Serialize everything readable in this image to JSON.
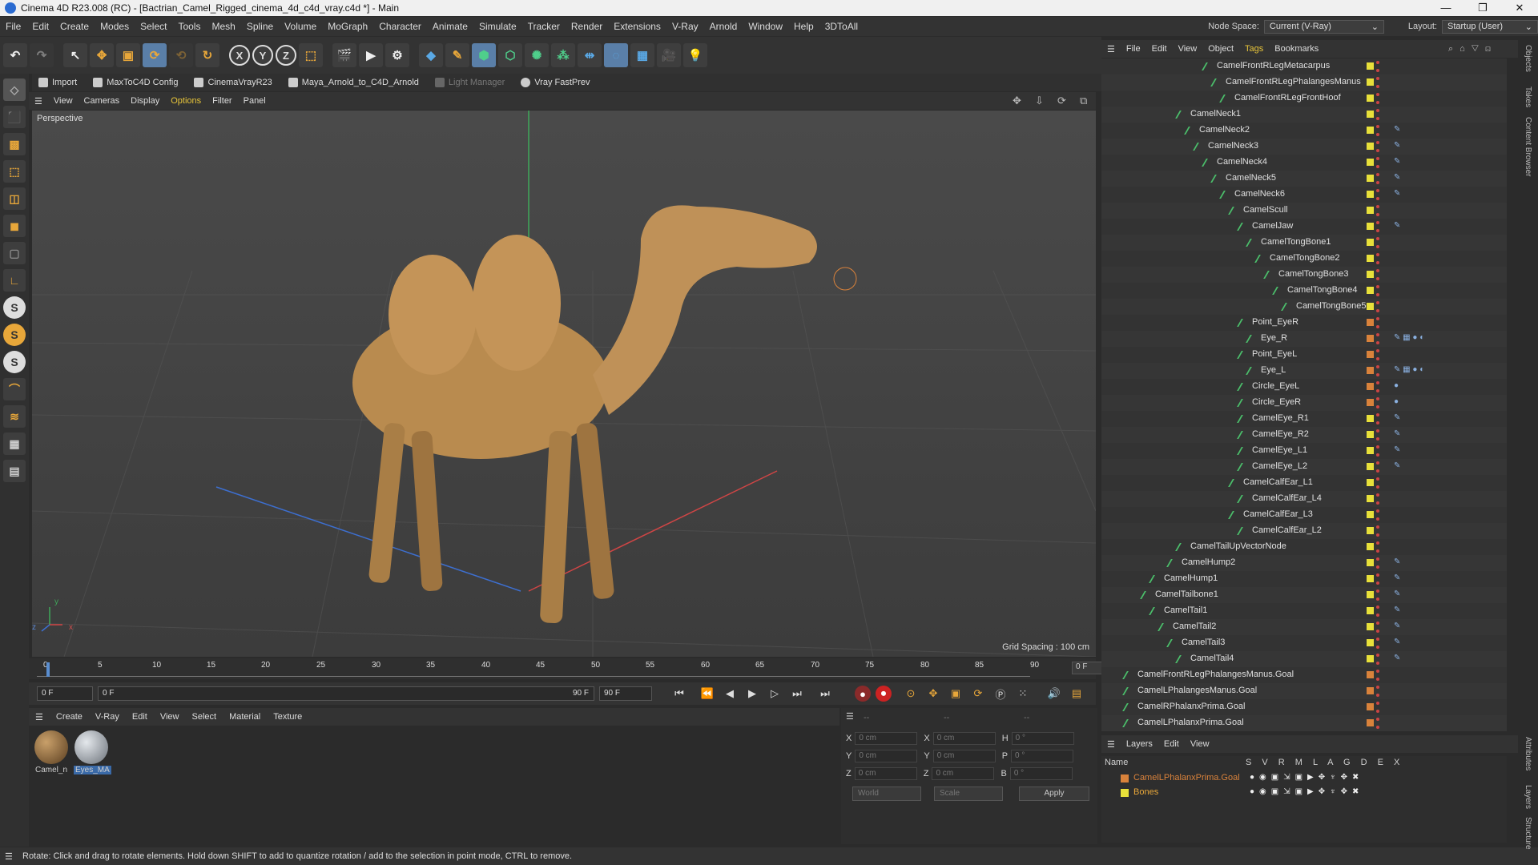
{
  "window": {
    "title": "Cinema 4D R23.008 (RC) - [Bactrian_Camel_Rigged_cinema_4d_c4d_vray.c4d *] - Main"
  },
  "menubar": {
    "items": [
      "File",
      "Edit",
      "Create",
      "Modes",
      "Select",
      "Tools",
      "Mesh",
      "Spline",
      "Volume",
      "MoGraph",
      "Character",
      "Animate",
      "Simulate",
      "Tracker",
      "Render",
      "Extensions",
      "V-Ray",
      "Arnold",
      "Window",
      "Help",
      "3DToAll"
    ],
    "node_space_label": "Node Space:",
    "node_space_value": "Current (V-Ray)",
    "layout_label": "Layout:",
    "layout_value": "Startup (User)"
  },
  "plugins": [
    "Import",
    "MaxToC4D Config",
    "CinemaVrayR23",
    "Maya_Arnold_to_C4D_Arnold",
    "Light Manager",
    "Vray FastPrev"
  ],
  "viewport": {
    "menu": [
      "View",
      "Cameras",
      "Display",
      "Options",
      "Filter",
      "Panel"
    ],
    "label": "Perspective",
    "grid_spacing": "Grid Spacing : 100 cm",
    "axis_y": "y",
    "axis_z": "z",
    "axis_x": "x"
  },
  "timeline": {
    "ticks": [
      "0",
      "5",
      "10",
      "15",
      "20",
      "25",
      "30",
      "35",
      "40",
      "45",
      "50",
      "55",
      "60",
      "65",
      "70",
      "75",
      "80",
      "85",
      "90"
    ],
    "frame_display": "0 F",
    "start_field": "0 F",
    "range_field": "0 F",
    "range_end": "90 F",
    "end_field": "90 F"
  },
  "material_manager": {
    "menu": [
      "Create",
      "V-Ray",
      "Edit",
      "View",
      "Select",
      "Material",
      "Texture"
    ],
    "materials": [
      {
        "name": "Camel_n",
        "color": "#8a6a3e"
      },
      {
        "name": "Eyes_MA",
        "color": "#9aa0a6"
      }
    ]
  },
  "coordinates": {
    "header_a": "--",
    "header_b": "--",
    "header_c": "--",
    "rows": [
      {
        "a": "X",
        "av": "0 cm",
        "b": "X",
        "bv": "0 cm",
        "c": "H",
        "cv": "0 °"
      },
      {
        "a": "Y",
        "av": "0 cm",
        "b": "Y",
        "bv": "0 cm",
        "c": "P",
        "cv": "0 °"
      },
      {
        "a": "Z",
        "av": "0 cm",
        "b": "Z",
        "bv": "0 cm",
        "c": "B",
        "cv": "0 °"
      }
    ],
    "mode": "World",
    "transform": "Scale",
    "apply": "Apply"
  },
  "status": "Rotate: Click and drag to rotate elements. Hold down SHIFT to add to quantize rotation / add to the selection in point mode, CTRL to remove.",
  "object_manager": {
    "menu": [
      "File",
      "Edit",
      "View",
      "Object",
      "Tags",
      "Bookmarks"
    ],
    "rows": [
      {
        "name": "CamelFrontRLegMetacarpus",
        "depth": 10,
        "color": "#e8e03a",
        "tags": ""
      },
      {
        "name": "CamelFrontRLegPhalangesManus",
        "depth": 11,
        "color": "#e8e03a",
        "tags": ""
      },
      {
        "name": "CamelFrontRLegFrontHoof",
        "depth": 12,
        "color": "#e8e03a",
        "tags": ""
      },
      {
        "name": "CamelNeck1",
        "depth": 7,
        "color": "#e8e03a",
        "tags": ""
      },
      {
        "name": "CamelNeck2",
        "depth": 8,
        "color": "#e8e03a",
        "tags": "✎"
      },
      {
        "name": "CamelNeck3",
        "depth": 9,
        "color": "#e8e03a",
        "tags": "✎"
      },
      {
        "name": "CamelNeck4",
        "depth": 10,
        "color": "#e8e03a",
        "tags": "✎"
      },
      {
        "name": "CamelNeck5",
        "depth": 11,
        "color": "#e8e03a",
        "tags": "✎"
      },
      {
        "name": "CamelNeck6",
        "depth": 12,
        "color": "#e8e03a",
        "tags": "✎"
      },
      {
        "name": "CamelScull",
        "depth": 13,
        "color": "#e8e03a",
        "tags": ""
      },
      {
        "name": "CamelJaw",
        "depth": 14,
        "color": "#e8e03a",
        "tags": "✎"
      },
      {
        "name": "CamelTongBone1",
        "depth": 15,
        "color": "#e8e03a",
        "tags": ""
      },
      {
        "name": "CamelTongBone2",
        "depth": 16,
        "color": "#e8e03a",
        "tags": ""
      },
      {
        "name": "CamelTongBone3",
        "depth": 17,
        "color": "#e8e03a",
        "tags": ""
      },
      {
        "name": "CamelTongBone4",
        "depth": 18,
        "color": "#e8e03a",
        "tags": ""
      },
      {
        "name": "CamelTongBone5",
        "depth": 19,
        "color": "#e8e03a",
        "tags": ""
      },
      {
        "name": "Point_EyeR",
        "depth": 14,
        "color": "#d9823b",
        "tags": ""
      },
      {
        "name": "Eye_R",
        "depth": 15,
        "color": "#d9823b",
        "tags": "✎ ▦ ● ◐"
      },
      {
        "name": "Point_EyeL",
        "depth": 14,
        "color": "#d9823b",
        "tags": ""
      },
      {
        "name": "Eye_L",
        "depth": 15,
        "color": "#d9823b",
        "tags": "✎ ▦ ● ◐"
      },
      {
        "name": "Circle_EyeL",
        "depth": 14,
        "color": "#d9823b",
        "tags": "●"
      },
      {
        "name": "Circle_EyeR",
        "depth": 14,
        "color": "#d9823b",
        "tags": "●"
      },
      {
        "name": "CamelEye_R1",
        "depth": 14,
        "color": "#e8e03a",
        "tags": "✎"
      },
      {
        "name": "CamelEye_R2",
        "depth": 14,
        "color": "#e8e03a",
        "tags": "✎"
      },
      {
        "name": "CamelEye_L1",
        "depth": 14,
        "color": "#e8e03a",
        "tags": "✎"
      },
      {
        "name": "CamelEye_L2",
        "depth": 14,
        "color": "#e8e03a",
        "tags": "✎"
      },
      {
        "name": "CamelCalfEar_L1",
        "depth": 13,
        "color": "#e8e03a",
        "tags": ""
      },
      {
        "name": "CamelCalfEar_L4",
        "depth": 14,
        "color": "#e8e03a",
        "tags": ""
      },
      {
        "name": "CamelCalfEar_L3",
        "depth": 13,
        "color": "#e8e03a",
        "tags": ""
      },
      {
        "name": "CamelCalfEar_L2",
        "depth": 14,
        "color": "#e8e03a",
        "tags": ""
      },
      {
        "name": "CamelTailUpVectorNode",
        "depth": 7,
        "color": "#e8e03a",
        "tags": ""
      },
      {
        "name": "CamelHump2",
        "depth": 6,
        "color": "#e8e03a",
        "tags": "✎"
      },
      {
        "name": "CamelHump1",
        "depth": 4,
        "color": "#e8e03a",
        "tags": "✎"
      },
      {
        "name": "CamelTailbone1",
        "depth": 3,
        "color": "#e8e03a",
        "tags": "✎"
      },
      {
        "name": "CamelTail1",
        "depth": 4,
        "color": "#e8e03a",
        "tags": "✎"
      },
      {
        "name": "CamelTail2",
        "depth": 5,
        "color": "#e8e03a",
        "tags": "✎"
      },
      {
        "name": "CamelTail3",
        "depth": 6,
        "color": "#e8e03a",
        "tags": "✎"
      },
      {
        "name": "CamelTail4",
        "depth": 7,
        "color": "#e8e03a",
        "tags": "✎"
      },
      {
        "name": "CamelFrontRLegPhalangesManus.Goal",
        "depth": 1,
        "color": "#d9823b",
        "tags": ""
      },
      {
        "name": "CamelLPhalangesManus.Goal",
        "depth": 1,
        "color": "#d9823b",
        "tags": ""
      },
      {
        "name": "CamelRPhalanxPrima.Goal",
        "depth": 1,
        "color": "#d9823b",
        "tags": ""
      },
      {
        "name": "CamelLPhalanxPrima.Goal",
        "depth": 1,
        "color": "#d9823b",
        "tags": ""
      }
    ]
  },
  "layers": {
    "menu": [
      "Layers",
      "Edit",
      "View"
    ],
    "col_name": "Name",
    "cols": "S V R M L A G D E X",
    "rows": [
      {
        "name": "CamelLPhalanxPrima.Goal",
        "color": "#d9823b",
        "text_color": "#d9823b"
      },
      {
        "name": "Bones",
        "color": "#e8e03a",
        "text_color": "#e8a73a"
      }
    ]
  },
  "side_tabs": [
    "Objects",
    "Takes",
    "Content Browser",
    "Attributes",
    "Layers",
    "Structure"
  ]
}
